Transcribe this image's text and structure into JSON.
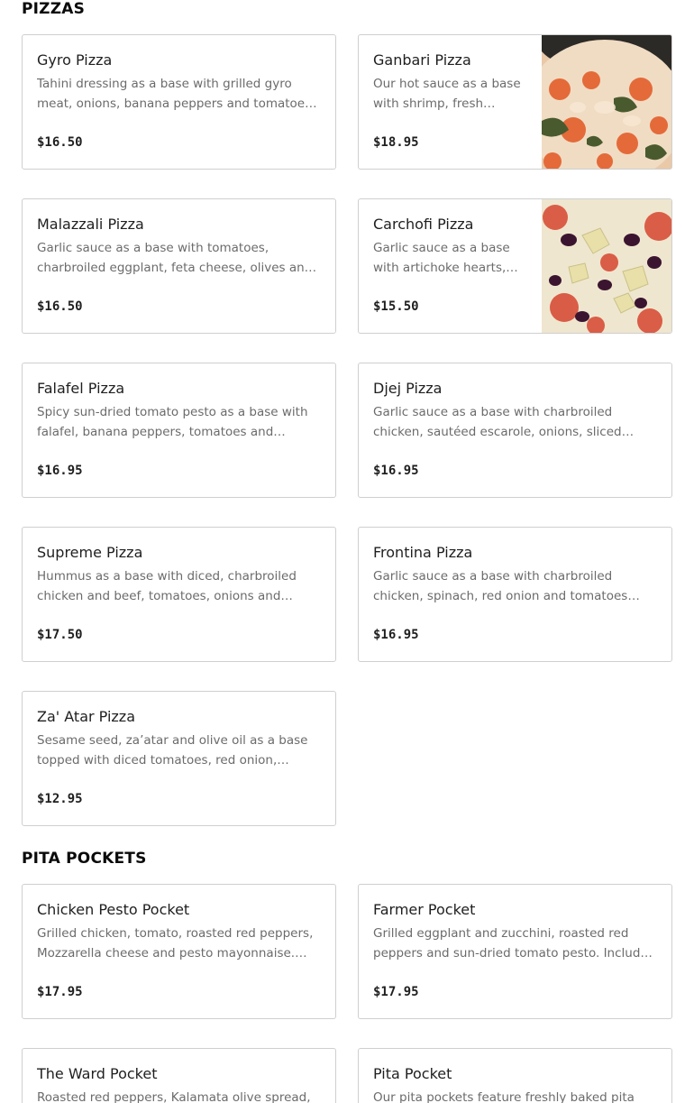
{
  "sections": {
    "pizzas": {
      "title": "PIZZAS",
      "items": [
        {
          "name": "Gyro Pizza",
          "desc": "Tahini dressing as a base with grilled gyro meat, onions, banana peppers and tomatoes. Topped with feta cheese.",
          "price": "$16.50"
        },
        {
          "name": "Ganbari Pizza",
          "desc": "Our hot sauce as a base with shrimp, fresh spinach and mozzarella cheese.",
          "price": "$18.95",
          "image": "spinach-shrimp-pizza-photo"
        },
        {
          "name": "Malazzali Pizza",
          "desc": "Garlic sauce as a base with tomatoes, charbroiled eggplant, feta cheese, olives and parsley.",
          "price": "$16.50"
        },
        {
          "name": "Carchofi Pizza",
          "desc": "Garlic sauce as a base with artichoke hearts, kalamata olives and tomatoes.",
          "price": "$15.50",
          "image": "artichoke-olive-pizza-photo"
        },
        {
          "name": "Falafel Pizza",
          "desc": "Spicy sun-dried tomato pesto as a base with falafel, banana peppers, tomatoes and parsley topped with tahini.",
          "price": "$16.95"
        },
        {
          "name": "Djej Pizza",
          "desc": "Garlic sauce as a base with charbroiled chicken, sautéed escarole, onions, sliced tomatoes and mozzarella.",
          "price": "$16.95"
        },
        {
          "name": "Supreme Pizza",
          "desc": "Hummus as a base with diced, charbroiled chicken and beef, tomatoes, onions and cheddar cheese.",
          "price": "$17.50"
        },
        {
          "name": "Frontina Pizza",
          "desc": "Garlic sauce as a base with charbroiled chicken, spinach, red onion and tomatoes with feta cheese.",
          "price": "$16.95"
        },
        {
          "name": "Za' Atar Pizza",
          "desc": "Sesame seed, za’atar and olive oil as a base topped with diced tomatoes, red onion, kalamata olives.",
          "price": "$12.95"
        }
      ]
    },
    "pita_pockets": {
      "title": "PITA POCKETS",
      "items": [
        {
          "name": "Chicken Pesto Pocket",
          "desc": "Grilled chicken, tomato, roasted red peppers, Mozzarella cheese and pesto mayonnaise. Includes a side.",
          "price": "$17.95"
        },
        {
          "name": "Farmer Pocket",
          "desc": "Grilled eggplant and zucchini, roasted red peppers and sun-dried tomato pesto. Includes a side.",
          "price": "$17.95"
        },
        {
          "name": "The Ward Pocket",
          "desc": "Roasted red peppers, Kalamata olive spread, feta cheese and greens.",
          "price": ""
        },
        {
          "name": "Pita Pocket",
          "desc": "Our pita pockets feature freshly baked pita bread stuffed with your choice of filling.",
          "price": ""
        }
      ]
    }
  },
  "colors": {
    "card_border": "#cfcfcf",
    "title_text": "#1f1f1f",
    "desc_text": "#6b6b6b",
    "background": "#ffffff"
  }
}
